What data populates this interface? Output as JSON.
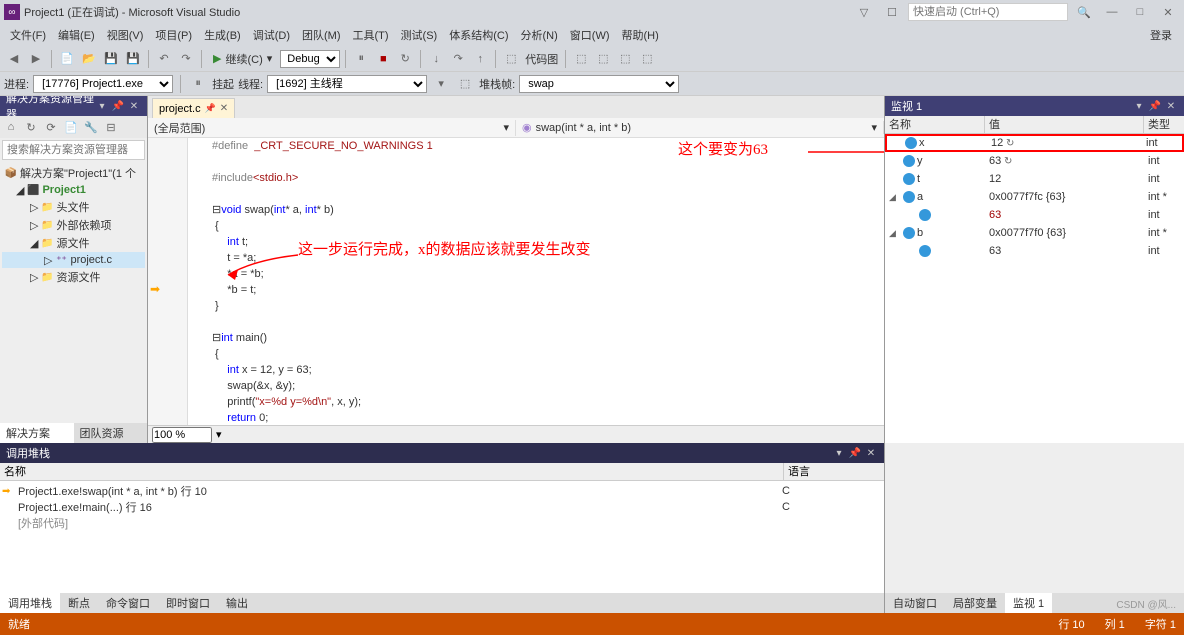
{
  "titlebar": {
    "title": "Project1 (正在调试) - Microsoft Visual Studio",
    "quick_launch": "快速启动 (Ctrl+Q)"
  },
  "menubar": {
    "items": [
      "文件(F)",
      "编辑(E)",
      "视图(V)",
      "项目(P)",
      "生成(B)",
      "调试(D)",
      "团队(M)",
      "工具(T)",
      "测试(S)",
      "体系结构(C)",
      "分析(N)",
      "窗口(W)",
      "帮助(H)"
    ],
    "signin": "登录"
  },
  "toolbar": {
    "continue": "继续(C)",
    "debug_config": "Debug"
  },
  "toolbar2": {
    "process_label": "进程:",
    "process_value": "[17776] Project1.exe",
    "suspend_label": "挂起",
    "thread_label": "线程:",
    "thread_value": "[1692] 主线程",
    "stack_label": "堆栈帧:",
    "stack_value": "swap"
  },
  "solution": {
    "panel_title": "解决方案资源管理器",
    "search_placeholder": "搜索解决方案资源管理器",
    "root": "解决方案\"Project1\"(1 个",
    "project": "Project1",
    "folders": [
      "头文件",
      "外部依赖项",
      "源文件",
      "资源文件"
    ],
    "file": "project.c",
    "tabs": [
      "解决方案资...",
      "团队资源管..."
    ]
  },
  "editor": {
    "tab_name": "project.c",
    "nav_scope": "(全局范围)",
    "nav_func": "swap(int * a, int * b)",
    "zoom": "100 %",
    "annotation1": "这个要变为63",
    "annotation2": "这一步运行完成，x的数据应该就要发生改变"
  },
  "watch": {
    "panel_title": "监视 1",
    "col_name": "名称",
    "col_value": "值",
    "col_type": "类型",
    "rows": [
      {
        "name": "x",
        "value": "12",
        "type": "int",
        "highlight": true,
        "refresh": true
      },
      {
        "name": "y",
        "value": "63",
        "type": "int",
        "refresh": true
      },
      {
        "name": "t",
        "value": "12",
        "type": "int"
      },
      {
        "name": "a",
        "value": "0x0077f7fc {63}",
        "type": "int *",
        "expandable": true
      },
      {
        "name": "",
        "value": "63",
        "type": "int",
        "indent": 1,
        "red": true
      },
      {
        "name": "b",
        "value": "0x0077f7f0 {63}",
        "type": "int *",
        "expandable": true
      },
      {
        "name": "",
        "value": "63",
        "type": "int",
        "indent": 1
      }
    ]
  },
  "callstack": {
    "panel_title": "调用堆栈",
    "col_name": "名称",
    "col_lang": "语言",
    "rows": [
      {
        "text": "Project1.exe!swap(int * a, int * b) 行 10",
        "lang": "C",
        "current": true
      },
      {
        "text": "Project1.exe!main(...) 行 16",
        "lang": "C"
      },
      {
        "text": "[外部代码]",
        "ext": true
      }
    ],
    "tabs": [
      "调用堆栈",
      "断点",
      "命令窗口",
      "即时窗口",
      "输出"
    ]
  },
  "bottom_right": {
    "tabs": [
      "自动窗口",
      "局部变量",
      "监视 1"
    ]
  },
  "statusbar": {
    "ready": "就绪",
    "line": "行 10",
    "col": "列 1",
    "char": "字符 1"
  },
  "watermark": "CSDN @风..."
}
